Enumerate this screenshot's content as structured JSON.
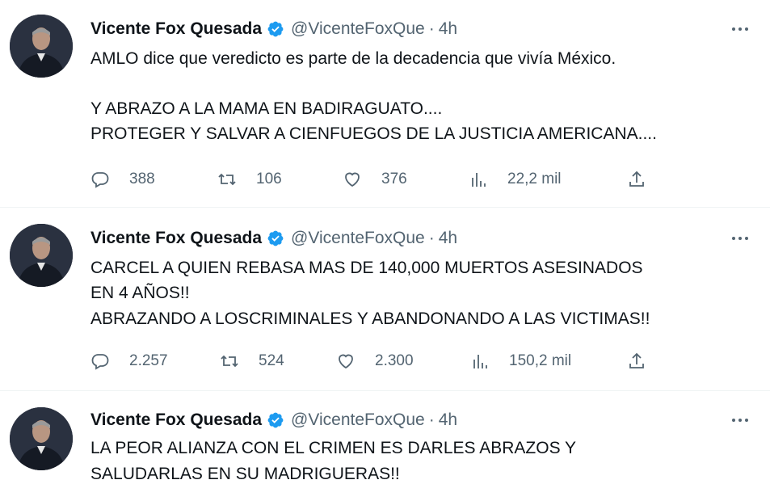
{
  "tweets": [
    {
      "author_name": "Vicente Fox Quesada",
      "handle": "@VicenteFoxQue",
      "separator": "·",
      "time": "4h",
      "lines": [
        "AMLO dice que veredicto es parte de la decadencia que vivía México.",
        "",
        "Y ABRAZO A LA MAMA EN BADIRAGUATO....",
        "PROTEGER Y SALVAR A CIENFUEGOS DE LA JUSTICIA AMERICANA...."
      ],
      "replies": "388",
      "retweets": "106",
      "likes": "376",
      "views": "22,2 mil"
    },
    {
      "author_name": "Vicente Fox Quesada",
      "handle": "@VicenteFoxQue",
      "separator": "·",
      "time": "4h",
      "lines": [
        "CARCEL A QUIEN REBASA MAS DE 140,000 MUERTOS ASESINADOS",
        "EN 4 AÑOS!!",
        "ABRAZANDO A LOSCRIMINALES Y ABANDONANDO A LAS VICTIMAS!!"
      ],
      "replies": "2.257",
      "retweets": "524",
      "likes": "2.300",
      "views": "150,2 mil"
    },
    {
      "author_name": "Vicente Fox Quesada",
      "handle": "@VicenteFoxQue",
      "separator": "·",
      "time": "4h",
      "lines": [
        "LA PEOR ALIANZA CON EL CRIMEN ES DARLES ABRAZOS Y",
        "SALUDARLAS EN SU MADRIGUERAS!!"
      ]
    }
  ],
  "icons": {
    "reply": "reply-icon",
    "retweet": "retweet-icon",
    "like": "heart-icon",
    "views": "views-icon",
    "share": "share-icon",
    "verified": "verified-badge-icon",
    "more": "more-icon"
  },
  "colors": {
    "verified": "#1d9bf0",
    "secondary_text": "#536471",
    "primary_text": "#0f1419",
    "divider": "#eff3f4"
  }
}
